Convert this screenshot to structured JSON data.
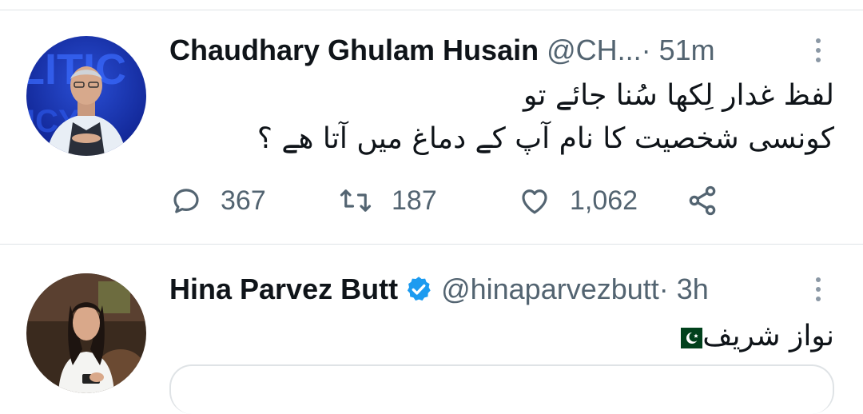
{
  "tweets": [
    {
      "name": "Chaudhary Ghulam Husain",
      "handle": "@CH...",
      "time": " · 51m",
      "verified": false,
      "body_lines": [
        "لفظ غدار لِکھا سُنا جائے تو",
        "کونسی شخصیت کا نام آپ کے دماغ میں آتا ھے ؟"
      ],
      "actions": {
        "reply_count": "367",
        "retweet_count": "187",
        "like_count": "1,062"
      }
    },
    {
      "name": "Hina Parvez Butt",
      "handle": "@hinaparvezbutt",
      "time": " · 3h",
      "verified": true,
      "body_lines": [
        "نواز شریف"
      ],
      "flag_icon": "pakistan-flag-icon"
    }
  ],
  "colors": {
    "text": "#0f1419",
    "secondary": "#536471",
    "verified_blue": "#1d9bf0",
    "divider": "#dfe3e6"
  }
}
